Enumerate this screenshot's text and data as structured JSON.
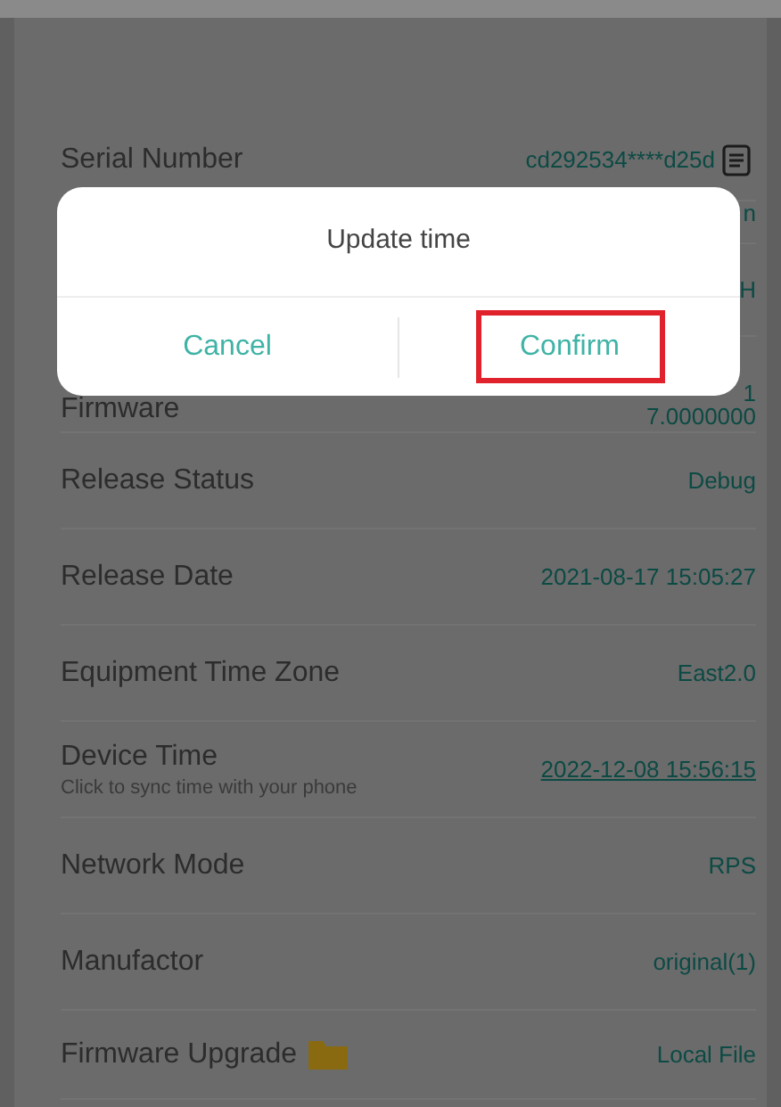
{
  "rows": [
    {
      "kind": "copyable",
      "label": "Serial Number",
      "value_lines": [
        "cd292534****d25d"
      ]
    },
    {
      "kind": "hidden",
      "value_lines": [
        "n"
      ]
    },
    {
      "kind": "hidden",
      "value_lines": [
        "H"
      ]
    },
    {
      "kind": "hidden",
      "label": "Firmware",
      "value_lines": [
        "1",
        "7.0000000"
      ]
    },
    {
      "kind": "text",
      "label": "Release Status",
      "value_lines": [
        "Debug"
      ]
    },
    {
      "kind": "text",
      "label": "Release Date",
      "value_lines": [
        "2021-08-17 15:05:27"
      ]
    },
    {
      "kind": "text",
      "label": "Equipment Time Zone",
      "value_lines": [
        "East2.0"
      ]
    },
    {
      "kind": "link",
      "label": "Device Time",
      "sublabel": "Click to sync time with your phone",
      "value_lines": [
        "2022-12-08 15:56:15"
      ]
    },
    {
      "kind": "text",
      "label": "Network Mode",
      "value_lines": [
        "RPS"
      ]
    },
    {
      "kind": "text",
      "label": "Manufactor",
      "value_lines": [
        "original(1)"
      ]
    },
    {
      "kind": "file",
      "label": "Firmware Upgrade",
      "value_lines": [
        "Local File"
      ]
    }
  ],
  "dialog": {
    "title": "Update time",
    "buttons": [
      {
        "label": "Cancel",
        "highlighted": false
      },
      {
        "label": "Confirm",
        "highlighted": true
      }
    ]
  }
}
